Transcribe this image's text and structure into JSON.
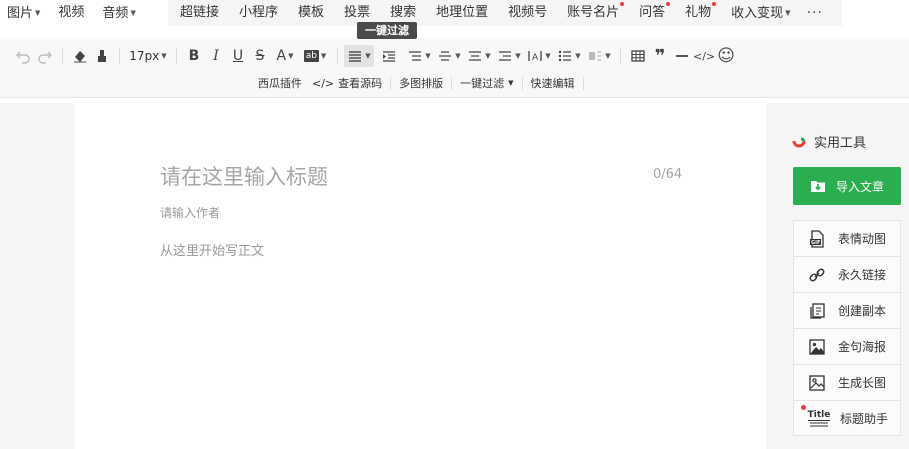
{
  "insert_menu": {
    "left_items": [
      {
        "label": "图片",
        "dropdown": true
      },
      {
        "label": "视频",
        "dropdown": false
      },
      {
        "label": "音频",
        "dropdown": true
      }
    ],
    "right_items": [
      {
        "label": "超链接",
        "dot": false,
        "dropdown": false
      },
      {
        "label": "小程序",
        "dot": false,
        "dropdown": false
      },
      {
        "label": "模板",
        "dot": false,
        "dropdown": false
      },
      {
        "label": "投票",
        "dot": false,
        "dropdown": false
      },
      {
        "label": "搜索",
        "dot": false,
        "dropdown": false
      },
      {
        "label": "地理位置",
        "dot": false,
        "dropdown": false
      },
      {
        "label": "视频号",
        "dot": false,
        "dropdown": false
      },
      {
        "label": "账号名片",
        "dot": true,
        "dropdown": false
      },
      {
        "label": "问答",
        "dot": true,
        "dropdown": false
      },
      {
        "label": "礼物",
        "dot": true,
        "dropdown": false
      },
      {
        "label": "收入变现",
        "dot": false,
        "dropdown": true
      }
    ],
    "more": "···"
  },
  "tooltip": {
    "text": "一键过滤"
  },
  "format_toolbar": {
    "font_size": "17px",
    "bold": "B",
    "italic": "I",
    "underline": "U",
    "strike": "S",
    "font_color": "A",
    "bg_color": "ab",
    "quote": "❞",
    "code": "</>",
    "emoji": "☺"
  },
  "plugins_row": {
    "xigua": "西瓜插件",
    "view_source": "查看源码",
    "multi_image": "多图排版",
    "filter": "一键过滤",
    "quick_edit": "快速编辑"
  },
  "editor": {
    "title_placeholder": "请在这里输入标题",
    "title_count": "0/64",
    "author_placeholder": "请输入作者",
    "body_placeholder": "从这里开始写正文"
  },
  "sidebar": {
    "heading": "实用工具",
    "import_label": "导入文章",
    "tools": [
      {
        "label": "表情动图",
        "icon": "gif-icon",
        "dot": false
      },
      {
        "label": "永久链接",
        "icon": "link-icon",
        "dot": false
      },
      {
        "label": "创建副本",
        "icon": "copy-icon",
        "dot": false
      },
      {
        "label": "金句海报",
        "icon": "poster-icon",
        "dot": false
      },
      {
        "label": "生成长图",
        "icon": "image-icon",
        "dot": false
      },
      {
        "label": "标题助手",
        "icon": "title-icon",
        "dot": true
      }
    ],
    "title_icon_text": "Title"
  },
  "colors": {
    "accent_green": "#2aae4f",
    "notification_red": "#f03e3e"
  }
}
